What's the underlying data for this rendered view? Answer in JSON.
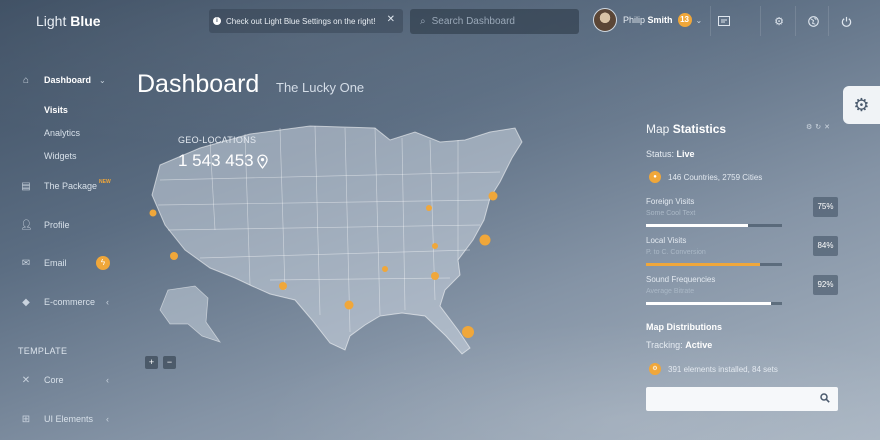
{
  "brand": {
    "light": "Light",
    "bold": "Blue"
  },
  "notice": {
    "text": "Check out Light Blue Settings on the right!",
    "close": "✕"
  },
  "search": {
    "placeholder": "Search Dashboard"
  },
  "user": {
    "first": "Philip",
    "last": "Smith",
    "notifications": "13"
  },
  "sidebar": {
    "items": [
      {
        "label": "Dashboard",
        "icon": "home-icon"
      },
      {
        "label": "The Package",
        "tag": "NEW",
        "icon": "database-icon"
      },
      {
        "label": "Profile",
        "icon": "user-icon"
      },
      {
        "label": "Email",
        "icon": "mail-icon",
        "badge_icon": "bolt-icon"
      },
      {
        "label": "E-commerce",
        "icon": "diamond-icon"
      },
      {
        "label": "Core",
        "icon": "tools-icon"
      },
      {
        "label": "UI Elements",
        "icon": "ui-icon"
      }
    ],
    "sub_items": [
      "Visits",
      "Analytics",
      "Widgets"
    ],
    "section_title": "TEMPLATE"
  },
  "page": {
    "title": "Dashboard",
    "subtitle": "The Lucky One"
  },
  "map": {
    "label": "GEO-LOCATIONS",
    "value": "1 543 453",
    "zoom_in": "+",
    "zoom_out": "−",
    "accent": "#f0a73a"
  },
  "panel": {
    "title_light": "Map",
    "title_bold": "Statistics",
    "status_label": "Status:",
    "status_value": "Live",
    "countries": "146 Countries, 2759 Cities",
    "stats": [
      {
        "label": "Foreign Visits",
        "sub": "Some Cool Text",
        "percent": "75%",
        "value": 0.75,
        "color": "#ffffff"
      },
      {
        "label": "Local Visits",
        "sub": "P. to C. Conversion",
        "percent": "84%",
        "value": 0.84,
        "color": "#f0a73a"
      },
      {
        "label": "Sound Frequencies",
        "sub": "Average Bitrate",
        "percent": "92%",
        "value": 0.92,
        "color": "#ffffff"
      }
    ],
    "distributions_title": "Map Distributions",
    "tracking_label": "Tracking:",
    "tracking_value": "Active",
    "installed": "391 elements installed, 84 sets"
  }
}
